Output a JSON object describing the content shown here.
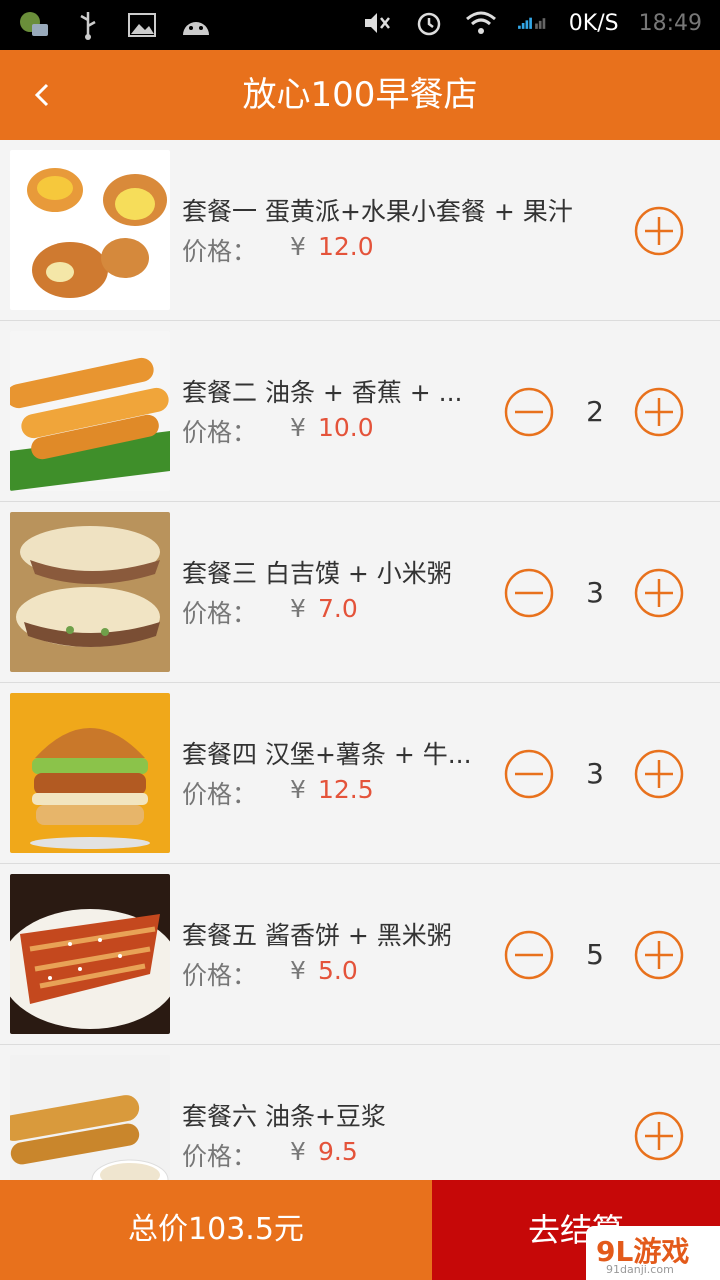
{
  "status_bar": {
    "left_icons": [
      "app-notification-icon",
      "usb-icon",
      "image-icon",
      "android-icon"
    ],
    "right_icons": [
      "mute-icon",
      "alarm-icon",
      "wifi-icon",
      "signal-icon"
    ],
    "speed": "0K/S",
    "time": "18:49"
  },
  "header": {
    "back_icon": "chevron-left-icon",
    "title": "放心100早餐店"
  },
  "items": [
    {
      "name": "套餐一 蛋黄派+水果小套餐 + 果汁",
      "price_label": "价格：",
      "currency": "¥",
      "price": "12.0",
      "qty": "",
      "show_minus": false
    },
    {
      "name": "套餐二 油条 + 香蕉 + ...",
      "price_label": "价格：",
      "currency": "¥",
      "price": "10.0",
      "qty": "2",
      "show_minus": true
    },
    {
      "name": "套餐三 白吉馍 + 小米粥",
      "price_label": "价格：",
      "currency": "¥",
      "price": "7.0",
      "qty": "3",
      "show_minus": true
    },
    {
      "name": "套餐四 汉堡+薯条 + 牛...",
      "price_label": "价格：",
      "currency": "¥",
      "price": "12.5",
      "qty": "3",
      "show_minus": true
    },
    {
      "name": "套餐五 酱香饼 + 黑米粥",
      "price_label": "价格：",
      "currency": "¥",
      "price": "5.0",
      "qty": "5",
      "show_minus": true
    },
    {
      "name": "套餐六 油条+豆浆",
      "price_label": "价格：",
      "currency": "¥",
      "price": "9.5",
      "qty": "",
      "show_minus": false
    }
  ],
  "footer": {
    "total": "总价103.5元",
    "checkout": "去结算"
  },
  "watermark": {
    "text": "9L游戏",
    "site": "91danji.com"
  },
  "colors": {
    "accent": "#e8711c",
    "price": "#e4533a",
    "checkout": "#c60808"
  }
}
